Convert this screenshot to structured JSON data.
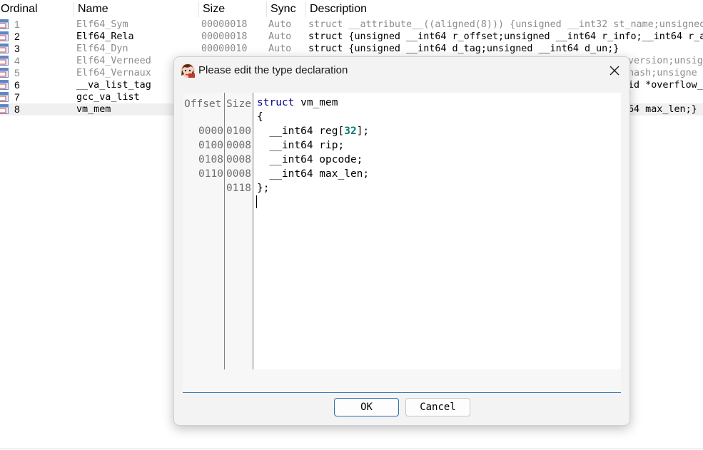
{
  "list": {
    "columns": [
      "Ordinal",
      "Name",
      "Size",
      "Sync",
      "Description"
    ],
    "rows": [
      {
        "ordinal": "1",
        "name": "Elf64_Sym",
        "size": "00000018",
        "sync": "Auto",
        "desc": "struct __attribute__((aligned(8))) {unsigned __int32 st_name;unsigned"
      },
      {
        "ordinal": "2",
        "name": "Elf64_Rela",
        "size": "00000018",
        "sync": "Auto",
        "desc": "struct {unsigned __int64 r_offset;unsigned __int64 r_info;__int64 r_a"
      },
      {
        "ordinal": "3",
        "name": "Elf64_Dyn",
        "size": "00000010",
        "sync": "Auto",
        "desc": "struct {unsigned __int64 d_tag;unsigned __int64 d_un;}"
      },
      {
        "ordinal": "4",
        "name": "Elf64_Verneed",
        "size": "",
        "sync": "",
        "desc": "version;unsig"
      },
      {
        "ordinal": "5",
        "name": "Elf64_Vernaux",
        "size": "",
        "sync": "",
        "desc": "hash;unsigne"
      },
      {
        "ordinal": "6",
        "name": "__va_list_tag",
        "size": "",
        "sync": "",
        "desc": "id *overflow_"
      },
      {
        "ordinal": "7",
        "name": "gcc_va_list",
        "size": "",
        "sync": "",
        "desc": ""
      },
      {
        "ordinal": "8",
        "name": "vm_mem",
        "size": "",
        "sync": "",
        "desc": "64 max_len;}"
      }
    ]
  },
  "dialog": {
    "title": "Please edit the type declaration",
    "gutter_headers": {
      "offset": "Offset",
      "size": "Size"
    },
    "lines": [
      {
        "offset": "",
        "size": "",
        "code_kw": "struct",
        "code_rest": " vm_mem",
        "code_num": "",
        "code_tail": ""
      },
      {
        "offset": "",
        "size": "",
        "code_kw": "",
        "code_rest": "{",
        "code_num": "",
        "code_tail": ""
      },
      {
        "offset": "0000",
        "size": "0100",
        "code_kw": "",
        "code_rest": "  __int64 reg[",
        "code_num": "32",
        "code_tail": "];"
      },
      {
        "offset": "0100",
        "size": "0008",
        "code_kw": "",
        "code_rest": "  __int64 rip;",
        "code_num": "",
        "code_tail": ""
      },
      {
        "offset": "0108",
        "size": "0008",
        "code_kw": "",
        "code_rest": "  __int64 opcode;",
        "code_num": "",
        "code_tail": ""
      },
      {
        "offset": "0110",
        "size": "0008",
        "code_kw": "",
        "code_rest": "  __int64 max_len;",
        "code_num": "",
        "code_tail": ""
      },
      {
        "offset": "",
        "size": "0118",
        "code_kw": "",
        "code_rest": "};",
        "code_num": "",
        "code_tail": ""
      }
    ],
    "ok_label": "OK",
    "cancel_label": "Cancel"
  },
  "colors": {
    "keyword": "#00008b",
    "number": "#007a7a",
    "accent": "#3a78b5"
  },
  "icons": {
    "row_icon": "struct-type-icon",
    "dialog_icon": "ida-app-icon",
    "close": "close-icon"
  }
}
